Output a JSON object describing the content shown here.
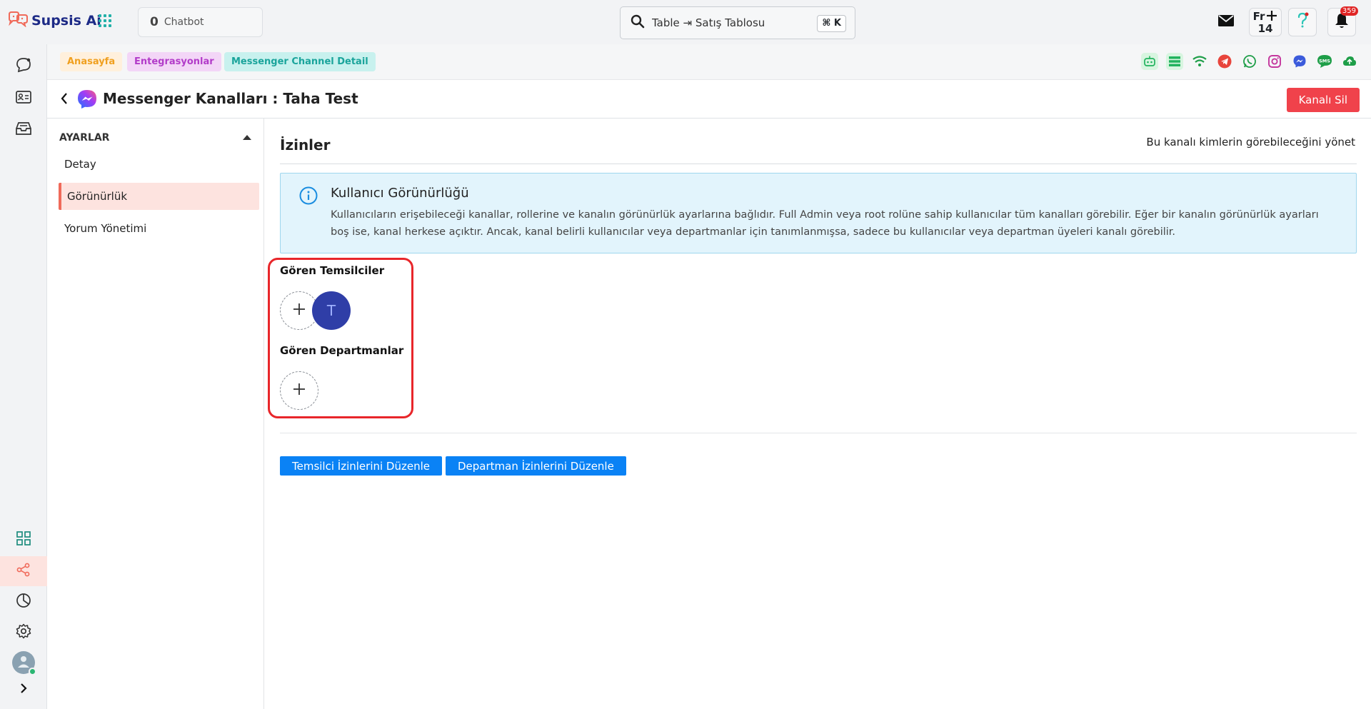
{
  "brand": {
    "name": "Supsis Ai",
    "accent": "#1d2a86",
    "logo_color": "#f06a5a"
  },
  "topbar": {
    "chatbot_count": "0",
    "chatbot_label": "Chatbot",
    "search_value": "Table ⇥ Satış Tablosu",
    "search_shortcut": "⌘ K",
    "fr_label": "Fr",
    "fr_number": "14",
    "notification_count": "359",
    "icons": [
      "mail-icon",
      "plus-icon",
      "help-icon",
      "bell-icon"
    ]
  },
  "rail": {
    "items": [
      "chat-icon",
      "contact-card-icon",
      "inbox-icon",
      "dashboard-icon",
      "share-icon",
      "analytics-icon",
      "settings-icon"
    ],
    "active": "share-icon"
  },
  "breadcrumb": {
    "items": [
      "Anasayfa",
      "Entegrasyonlar",
      "Messenger Channel Detail"
    ]
  },
  "channels": [
    "chatbot-icon",
    "list-icon",
    "wifi-icon",
    "telegram-icon",
    "whatsapp-icon",
    "instagram-icon",
    "messenger-icon",
    "sms-icon",
    "cloud-icon"
  ],
  "header": {
    "title": "Messenger Kanalları : Taha Test",
    "delete_label": "Kanalı Sil"
  },
  "settings_nav": {
    "heading": "AYARLAR",
    "items": [
      "Detay",
      "Görünürlük",
      "Yorum Yönetimi"
    ],
    "active_index": 1
  },
  "permissions": {
    "title": "İzinler",
    "description": "Bu kanalı kimlerin görebileceğini yönet",
    "info_title": "Kullanıcı Görünürlüğü",
    "info_body": "Kullanıcıların erişebileceği kanallar, rollerine ve kanalın görünürlük ayarlarına bağlıdır. Full Admin veya root rolüne sahip kullanıcılar tüm kanalları görebilir. Eğer bir kanalın görünürlük ayarları boş ise, kanal herkese açıktır. Ancak, kanal belirli kullanıcılar veya departmanlar için tanımlanmışsa, sadece bu kullanıcılar veya departman üyeleri kanalı görebilir.",
    "agents_label": "Gören Temsilciler",
    "agents": [
      "T"
    ],
    "departments_label": "Gören Departmanlar",
    "departments": [],
    "edit_agents_label": "Temsilci İzinlerini Düzenle",
    "edit_departments_label": "Departman İzinlerini Düzenle"
  }
}
